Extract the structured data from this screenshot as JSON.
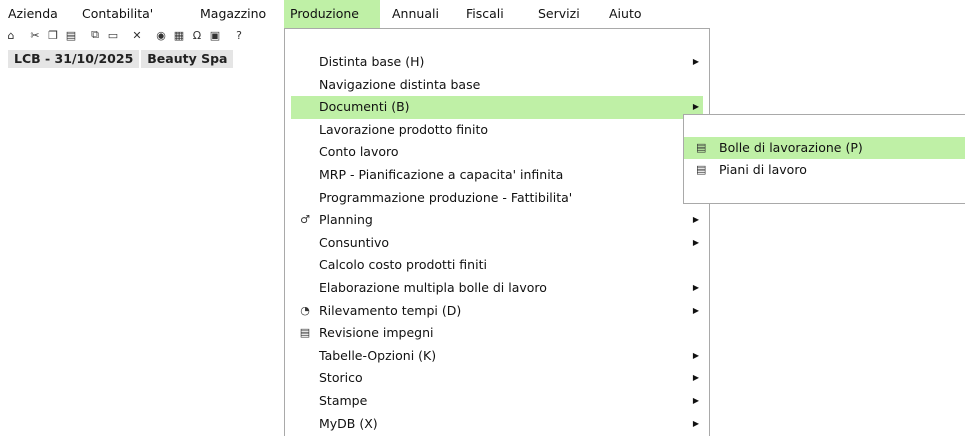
{
  "menubar": [
    {
      "label": "Azienda",
      "active": false
    },
    {
      "label": "Contabilita'",
      "active": false
    },
    {
      "label": "Magazzino",
      "active": false
    },
    {
      "label": "Produzione",
      "active": true
    },
    {
      "label": "Annuali",
      "active": false
    },
    {
      "label": "Fiscali",
      "active": false
    },
    {
      "label": "Servizi",
      "active": false
    },
    {
      "label": "Aiuto",
      "active": false
    }
  ],
  "toolbar": {
    "icons": [
      "home-icon",
      "scissors-icon",
      "copy-icon",
      "paste-icon",
      "network-icon",
      "computer-icon",
      "close-icon",
      "camera-icon",
      "calc-icon",
      "omega-icon",
      "grid-icon",
      "help-icon"
    ]
  },
  "company": {
    "code_date": "LCB - 31/10/2025",
    "name": "Beauty Spa"
  },
  "dropdown": {
    "items": [
      {
        "label": "Distinta base (H)",
        "submenu": true,
        "icon": ""
      },
      {
        "label": "Navigazione distinta base",
        "submenu": false,
        "icon": ""
      },
      {
        "label": "Documenti (B)",
        "submenu": true,
        "icon": "",
        "selected": true
      },
      {
        "label": "Lavorazione prodotto finito",
        "submenu": false,
        "icon": ""
      },
      {
        "label": "Conto lavoro",
        "submenu": false,
        "icon": ""
      },
      {
        "label": "MRP - Pianificazione a capacita' infinita",
        "submenu": false,
        "icon": ""
      },
      {
        "label": "Programmazione produzione - Fattibilita'",
        "submenu": false,
        "icon": ""
      },
      {
        "label": "Planning",
        "submenu": true,
        "icon": "planning-icon"
      },
      {
        "label": "Consuntivo",
        "submenu": true,
        "icon": ""
      },
      {
        "label": "Calcolo costo prodotti finiti",
        "submenu": false,
        "icon": ""
      },
      {
        "label": "Elaborazione multipla bolle di lavoro",
        "submenu": true,
        "icon": ""
      },
      {
        "label": "Rilevamento tempi (D)",
        "submenu": true,
        "icon": "clock-icon"
      },
      {
        "label": "Revisione impegni",
        "submenu": false,
        "icon": "review-icon"
      },
      {
        "label": "Tabelle-Opzioni (K)",
        "submenu": true,
        "icon": ""
      },
      {
        "label": "Storico",
        "submenu": true,
        "icon": ""
      },
      {
        "label": "Stampe",
        "submenu": true,
        "icon": ""
      },
      {
        "label": "MyDB (X)",
        "submenu": true,
        "icon": ""
      }
    ]
  },
  "submenu": {
    "items": [
      {
        "label": "Bolle di lavorazione (P)",
        "icon": "document-icon",
        "selected": true
      },
      {
        "label": "Piani di lavoro",
        "icon": "document-icon",
        "selected": false
      }
    ]
  },
  "colors": {
    "highlight": "#bff0a6",
    "border": "#a9a9a9",
    "company_bg": "#e5e5e5"
  }
}
